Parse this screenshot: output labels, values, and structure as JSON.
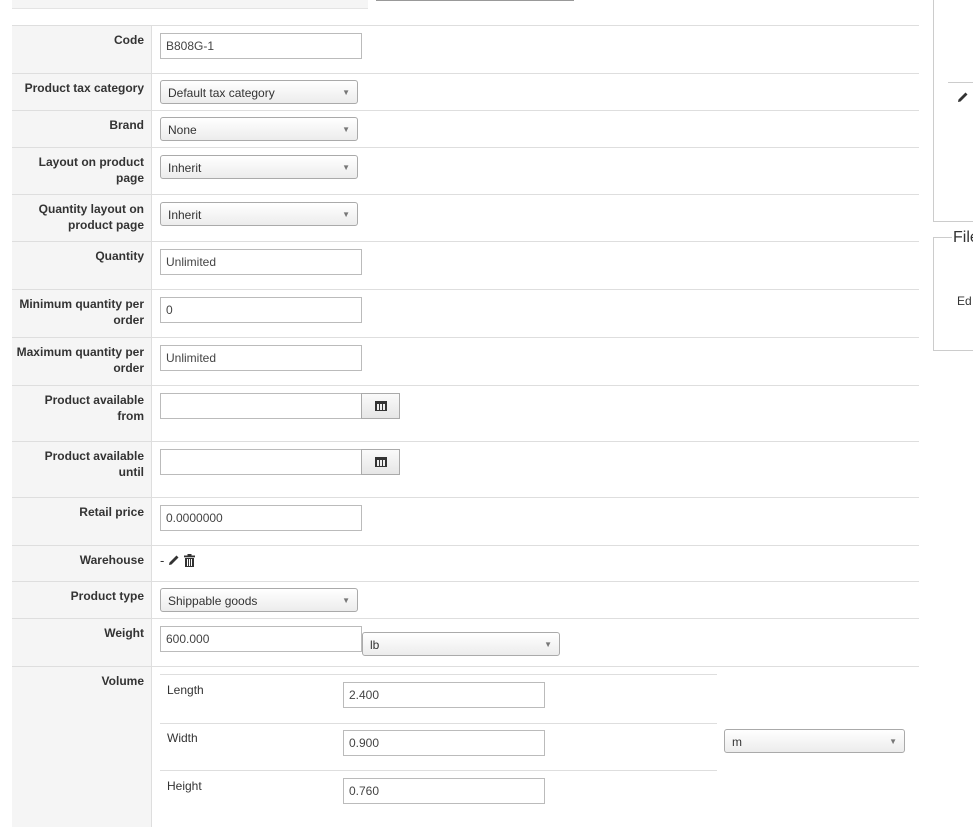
{
  "form": {
    "code": {
      "label": "Code",
      "value": "B808G-1"
    },
    "tax_category": {
      "label": "Product tax category",
      "value": "Default tax category"
    },
    "brand": {
      "label": "Brand",
      "value": "None"
    },
    "layout": {
      "label": "Layout on product page",
      "value": "Inherit"
    },
    "quantity_layout": {
      "label": "Quantity layout on product page",
      "value": "Inherit"
    },
    "quantity": {
      "label": "Quantity",
      "value": "Unlimited"
    },
    "min_qty": {
      "label": "Minimum quantity per order",
      "value": "0"
    },
    "max_qty": {
      "label": "Maximum quantity per order",
      "value": "Unlimited"
    },
    "available_from": {
      "label": "Product available from",
      "value": ""
    },
    "available_until": {
      "label": "Product available until",
      "value": ""
    },
    "retail_price": {
      "label": "Retail price",
      "value": "0.0000000"
    },
    "warehouse": {
      "label": "Warehouse",
      "value": "-"
    },
    "product_type": {
      "label": "Product type",
      "value": "Shippable goods"
    },
    "weight": {
      "label": "Weight",
      "value": "600.000",
      "unit": "lb"
    },
    "volume": {
      "label": "Volume",
      "length": {
        "label": "Length",
        "value": "2.400"
      },
      "width": {
        "label": "Width",
        "value": "0.900"
      },
      "height": {
        "label": "Height",
        "value": "0.760"
      },
      "unit": "m"
    }
  },
  "side": {
    "files_title": "File",
    "edit_label": "Ed"
  },
  "icons": {
    "dropdown": "chevron-down-icon",
    "calendar": "calendar-icon",
    "edit": "pencil-icon",
    "delete": "trash-icon"
  }
}
